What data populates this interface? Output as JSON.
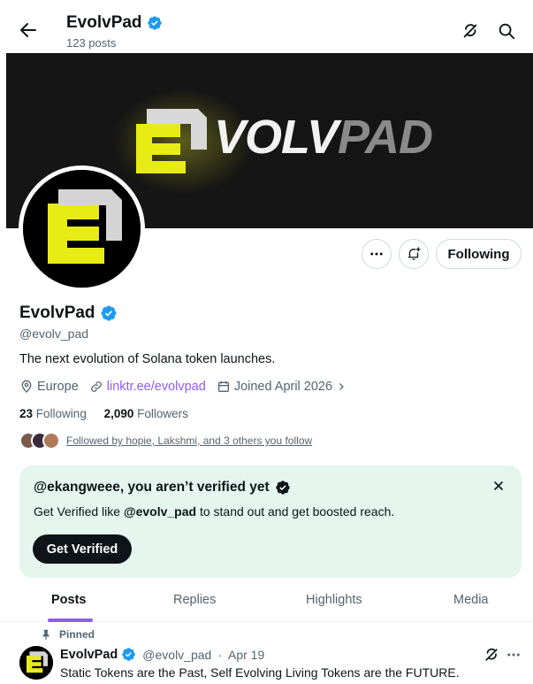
{
  "header": {
    "title": "EvolvPad",
    "subtitle": "123 posts"
  },
  "banner": {
    "logo_text_light": "VOLV",
    "logo_text_dark": "PAD"
  },
  "actions": {
    "following_label": "Following"
  },
  "profile": {
    "name": "EvolvPad",
    "handle": "@evolv_pad",
    "bio": "The next evolution of Solana token launches.",
    "location": "Europe",
    "link": "linktr.ee/evolvpad",
    "joined": "Joined April 2026",
    "following_count": "23",
    "following_label": "Following",
    "followers_count": "2,090",
    "followers_label": "Followers",
    "followed_by": "Followed by hopie, Lakshmi, and 3 others you follow"
  },
  "verify_card": {
    "title": "@ekangweee, you aren’t verified yet",
    "text_prefix": "Get Verified like ",
    "text_handle": "@evolv_pad",
    "text_suffix": " to stand out and get boosted reach.",
    "button": "Get Verified"
  },
  "tabs": [
    "Posts",
    "Replies",
    "Highlights",
    "Media"
  ],
  "post": {
    "pinned_label": "Pinned",
    "author": "EvolvPad",
    "handle": "@evolv_pad",
    "sep": "·",
    "date": "Apr 19",
    "text": "Static Tokens are the Past, Self Evolving Living Tokens are the FUTURE."
  },
  "colors": {
    "verified": "#1d9bf0",
    "logo_yellow": "#e8ec15",
    "tab_indicator": "#8e5cf0",
    "card_bg": "#e4f6ee"
  }
}
